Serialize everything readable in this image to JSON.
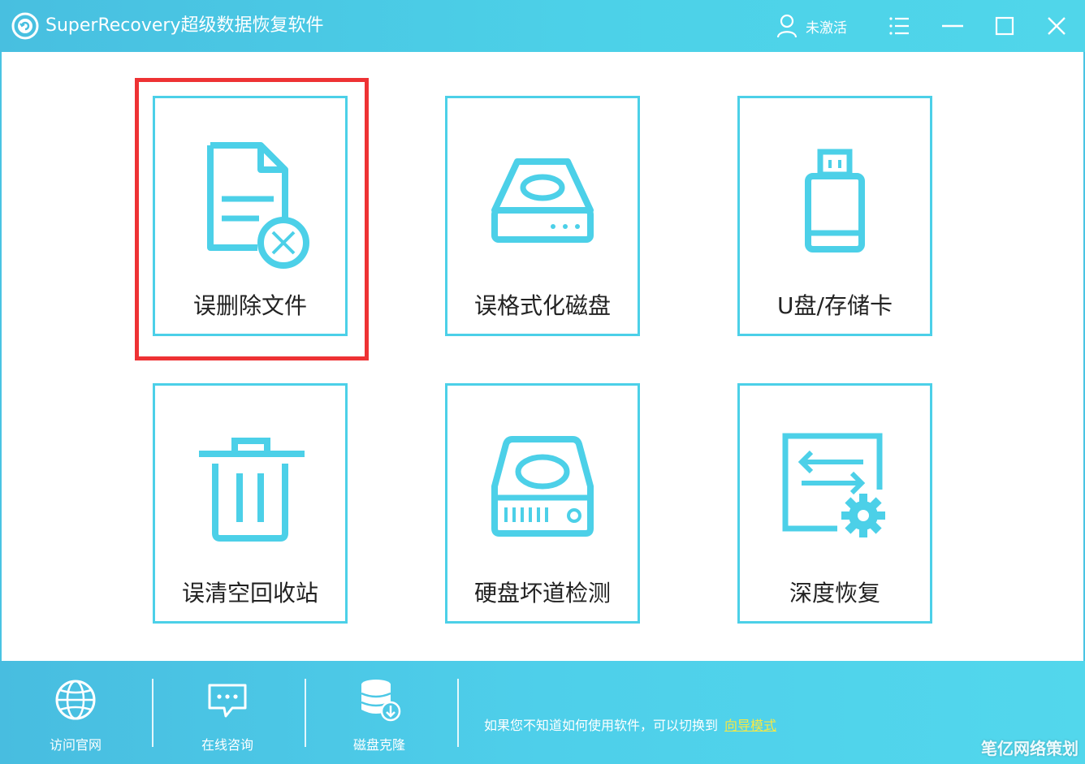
{
  "window": {
    "title": "SuperRecovery超级数据恢复软件",
    "account_label": "未激活",
    "icons": {
      "logo": "app-logo-icon",
      "user": "user-icon",
      "menu": "menu-icon",
      "minimize": "minimize-icon",
      "maximize": "maximize-icon",
      "close": "close-icon"
    }
  },
  "tiles": [
    {
      "id": "deleted-files",
      "label": "误删除文件",
      "icon": "deleted-file-icon",
      "selected": true
    },
    {
      "id": "formatted-disk",
      "label": "误格式化磁盘",
      "icon": "disk-drive-icon",
      "selected": false
    },
    {
      "id": "usb-card",
      "label": "U盘/存储卡",
      "icon": "usb-drive-icon",
      "selected": false
    },
    {
      "id": "recycle-bin",
      "label": "误清空回收站",
      "icon": "trash-icon",
      "selected": false
    },
    {
      "id": "bad-sector",
      "label": "硬盘坏道检测",
      "icon": "hard-disk-icon",
      "selected": false
    },
    {
      "id": "deep-recovery",
      "label": "深度恢复",
      "icon": "deep-recovery-icon",
      "selected": false
    }
  ],
  "footer": {
    "items": [
      {
        "label": "访问官网",
        "icon": "globe-icon"
      },
      {
        "label": "在线咨询",
        "icon": "chat-icon"
      },
      {
        "label": "磁盘克隆",
        "icon": "database-clone-icon"
      }
    ],
    "hint_text": "如果您不知道如何使用软件，可以切换到",
    "hint_link": "向导模式"
  },
  "watermark": "笔亿网络策划",
  "colors": {
    "accent": "#4cd0e8",
    "highlight": "#ee3234",
    "link": "#f7e843"
  }
}
